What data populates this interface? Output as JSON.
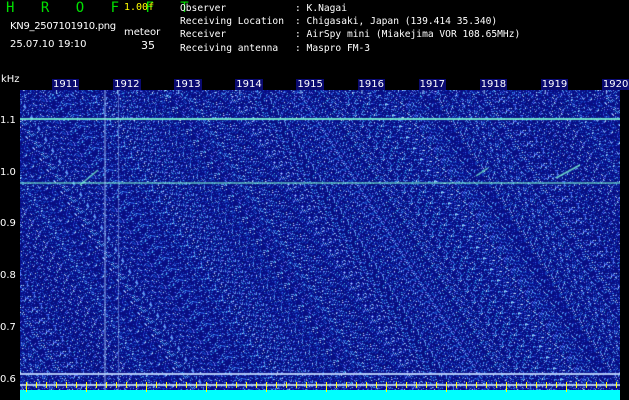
{
  "header": {
    "app_name": "HROFFT",
    "version": "1.00f",
    "filename": "KN9_2507101910.png",
    "mode": "meteor",
    "datetime": "25.07.10 19:10",
    "count": "35"
  },
  "station_info": [
    {
      "label": "Observer",
      "value": ": K.Nagai"
    },
    {
      "label": "Receiving Location",
      "value": ": Chigasaki, Japan (139.414 35.340)"
    },
    {
      "label": "Receiver",
      "value": ": AirSpy mini (Miakejima VOR 108.65MHz)"
    },
    {
      "label": "Receiving antenna",
      "value": ": Maspro FM-3"
    }
  ],
  "chart_data": {
    "type": "heatmap",
    "title": "",
    "ylabel": "kHz",
    "xlabel": "",
    "x_ticks": [
      "1911",
      "1912",
      "1913",
      "1914",
      "1915",
      "1916",
      "1917",
      "1918",
      "1919",
      "1920"
    ],
    "y_ticks": [
      "1.1",
      "1.0",
      "0.9",
      "0.8",
      "0.7",
      "0.6"
    ],
    "ylim": [
      0.58,
      1.16
    ],
    "colors": {
      "background": "#0a0f90",
      "noise": "#5a7cff",
      "signal": "#7fffd4",
      "floor": "#00ffff"
    }
  }
}
